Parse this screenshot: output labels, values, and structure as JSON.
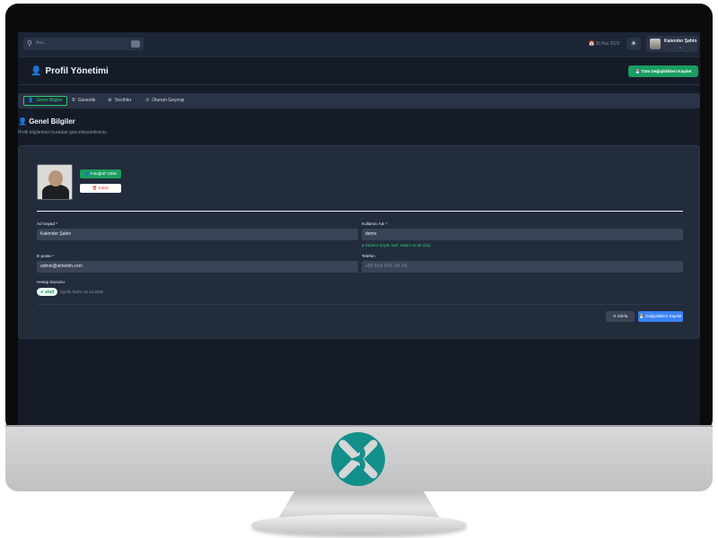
{
  "topbar": {
    "search_placeholder": "Ara...",
    "date": "30 Ara 2025",
    "user_name": "Kalender Şahin"
  },
  "header": {
    "title": "Profil Yönetimi",
    "save_all_label": "Tüm Değişiklikleri Kaydet"
  },
  "tabs": [
    {
      "label": "Genel Bilgiler",
      "icon": "user-icon",
      "active": true
    },
    {
      "label": "Güvenlik",
      "icon": "shield-icon",
      "active": false
    },
    {
      "label": "Tercihler",
      "icon": "gear-icon",
      "active": false
    },
    {
      "label": "Oturum Geçmişi",
      "icon": "history-icon",
      "active": false
    }
  ],
  "section": {
    "title": "Genel Bilgiler",
    "subtitle": "Profil bilgilerinizi buradan güncelleyebilirsiniz."
  },
  "profile": {
    "upload_label": "Fotoğraf Yükle",
    "remove_label": "Kaldır"
  },
  "form": {
    "name_label": "Ad Soyad *",
    "name_value": "Kalender Şahin",
    "username_label": "Kullanıcı Adı *",
    "username_value": "demo",
    "username_hint": "Sadece küçük harf, rakam ve alt çizgi",
    "email_label": "E-posta *",
    "email_value": "admin@sirketim.com",
    "phone_label": "Telefon",
    "phone_placeholder": "+90 5XX XXX XX XX",
    "status_label": "Hesap Durumu",
    "status_value": "Aktif",
    "member_since": "Üyelik Tarihi: 30.12.2025"
  },
  "actions": {
    "reset_label": "Sıfırla",
    "save_label": "Değişiklikleri Kaydet"
  },
  "colors": {
    "accent_green": "#1a9e61",
    "primary_blue": "#3b82f6",
    "background": "#151c28"
  }
}
